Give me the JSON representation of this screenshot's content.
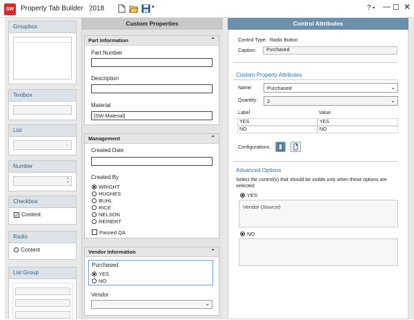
{
  "app": {
    "title": "Property Tab Builder",
    "year": "2018",
    "logo_text": "SW"
  },
  "window": {
    "help": "?",
    "minimize": "—",
    "maximize": "☐",
    "close": "✕"
  },
  "palette": {
    "groupbox": "Groupbox",
    "textbox": "Textbox",
    "list": "List",
    "number": "Number",
    "checkbox": "Checkbox",
    "checkbox_item": "Content",
    "radio": "Radio",
    "radio_item": "Content",
    "list_group": "List Group"
  },
  "custom": {
    "header": "Custom Properties",
    "part_info": {
      "title": "Part Information",
      "part_number_label": "Part Number",
      "part_number_value": "",
      "description_label": "Description",
      "description_value": "",
      "material_label": "Material",
      "material_value": "[SW-Material]"
    },
    "management": {
      "title": "Management",
      "created_date_label": "Created Date",
      "created_by_label": "Created By",
      "people": [
        "WRIGHT",
        "HUGHES",
        "BUHL",
        "RICE",
        "NELSON",
        "REINERT"
      ],
      "passed_qa": "Passed QA"
    },
    "vendor": {
      "title": "Vendor Information",
      "purchased_label": "Purchased",
      "yes": "YES",
      "no": "NO",
      "vendor_label": "Vendor"
    }
  },
  "attr": {
    "header": "Control Attributes",
    "control_type_label": "Control Type:",
    "control_type_value": "Radio Button",
    "caption_label": "Caption:",
    "caption_value": "Purchased",
    "cpa_title": "Custom Property Attributes",
    "name_label": "Name:",
    "name_value": "Purchased",
    "quantity_label": "Quantity:",
    "quantity_value": "2",
    "table_headers": [
      "Label",
      "Value"
    ],
    "table_rows": [
      [
        "YES",
        "YES"
      ],
      [
        "NO",
        "NO"
      ]
    ],
    "configurations_label": "Configurations:",
    "advanced_title": "Advanced Options",
    "advanced_desc_1": "Select the control(s) that should be visible only when these options are",
    "advanced_desc_2": "selected:",
    "opt_yes": "YES",
    "vendor_source": "Vendor (Source)",
    "opt_no": "NO"
  },
  "colors": {
    "accent": "#2d6ea6",
    "header_blue": "#6d8faa",
    "logo_red": "#d22b2b"
  }
}
